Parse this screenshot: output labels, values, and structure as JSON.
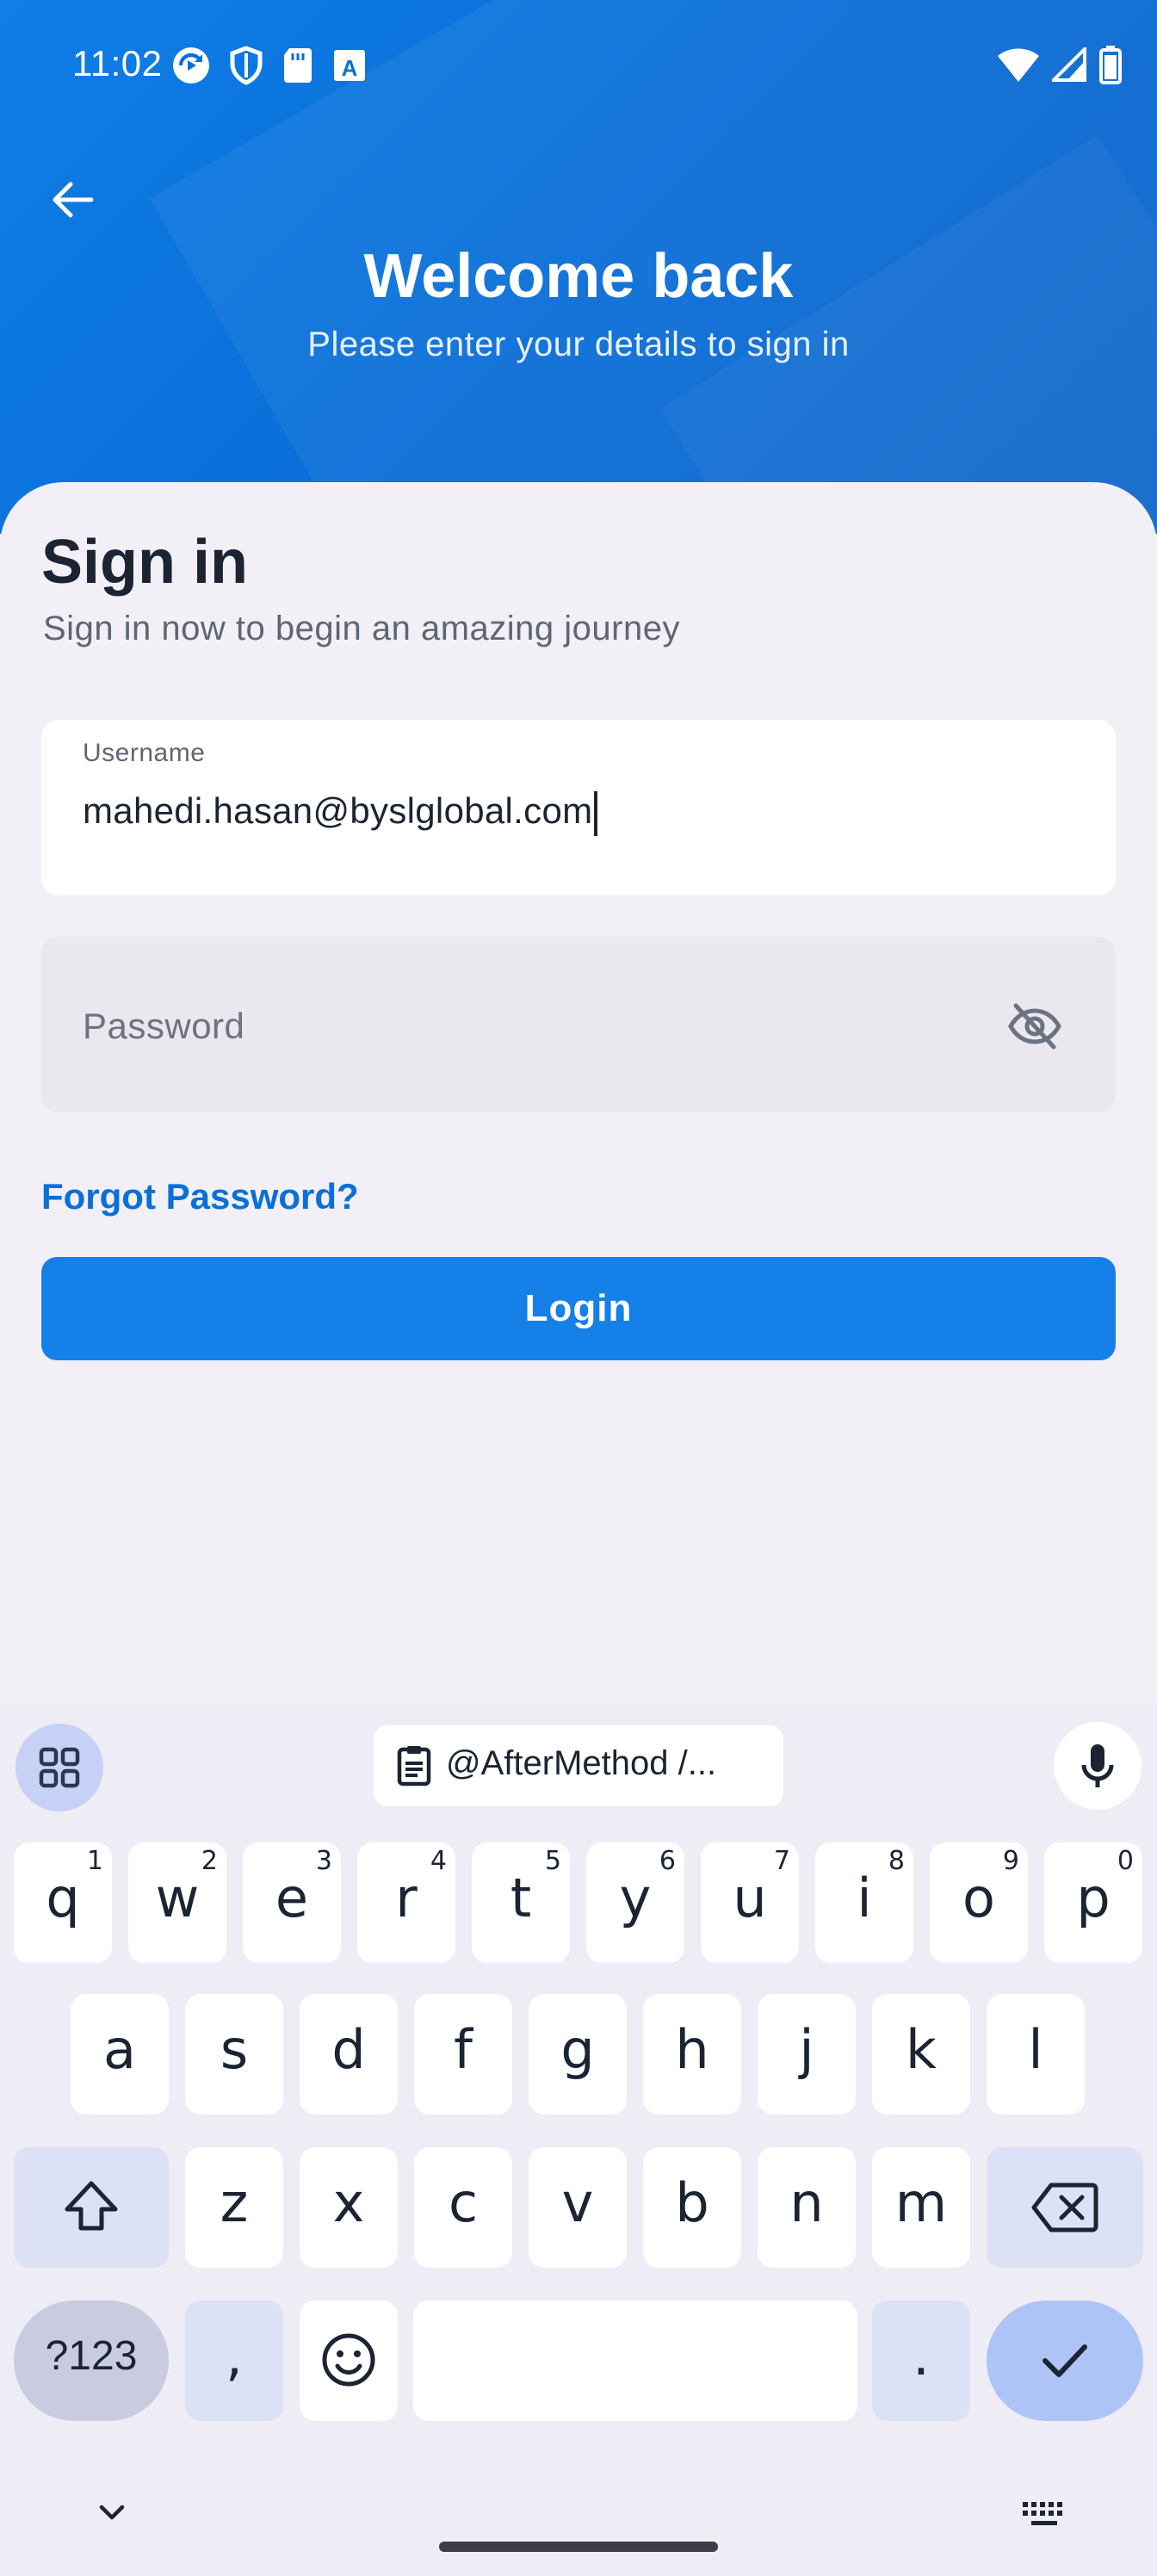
{
  "status_bar": {
    "time": "11:02",
    "left_icons": [
      "sync-icon",
      "shield-icon",
      "sd-card-icon",
      "font-icon"
    ],
    "right_icons": [
      "wifi-icon",
      "signal-icon",
      "battery-icon"
    ]
  },
  "header": {
    "title": "Welcome back",
    "subtitle": "Please enter your details to sign in",
    "accent_color": "#0a6fd9"
  },
  "form": {
    "title": "Sign in",
    "subtitle": "Sign in now to begin an amazing journey",
    "username_label": "Username",
    "username_value": "mahedi.hasan@byslglobal.com",
    "password_placeholder": "Password",
    "forgot_label": "Forgot Password?",
    "login_label": "Login"
  },
  "keyboard": {
    "clipboard_suggestion": "@AfterMethod  /...",
    "row1": [
      {
        "key": "q",
        "sup": "1"
      },
      {
        "key": "w",
        "sup": "2"
      },
      {
        "key": "e",
        "sup": "3"
      },
      {
        "key": "r",
        "sup": "4"
      },
      {
        "key": "t",
        "sup": "5"
      },
      {
        "key": "y",
        "sup": "6"
      },
      {
        "key": "u",
        "sup": "7"
      },
      {
        "key": "i",
        "sup": "8"
      },
      {
        "key": "o",
        "sup": "9"
      },
      {
        "key": "p",
        "sup": "0"
      }
    ],
    "row2": [
      "a",
      "s",
      "d",
      "f",
      "g",
      "h",
      "j",
      "k",
      "l"
    ],
    "row3": [
      "z",
      "x",
      "c",
      "v",
      "b",
      "n",
      "m"
    ],
    "symbols_label": "?123",
    "comma_label": ",",
    "period_label": "."
  }
}
